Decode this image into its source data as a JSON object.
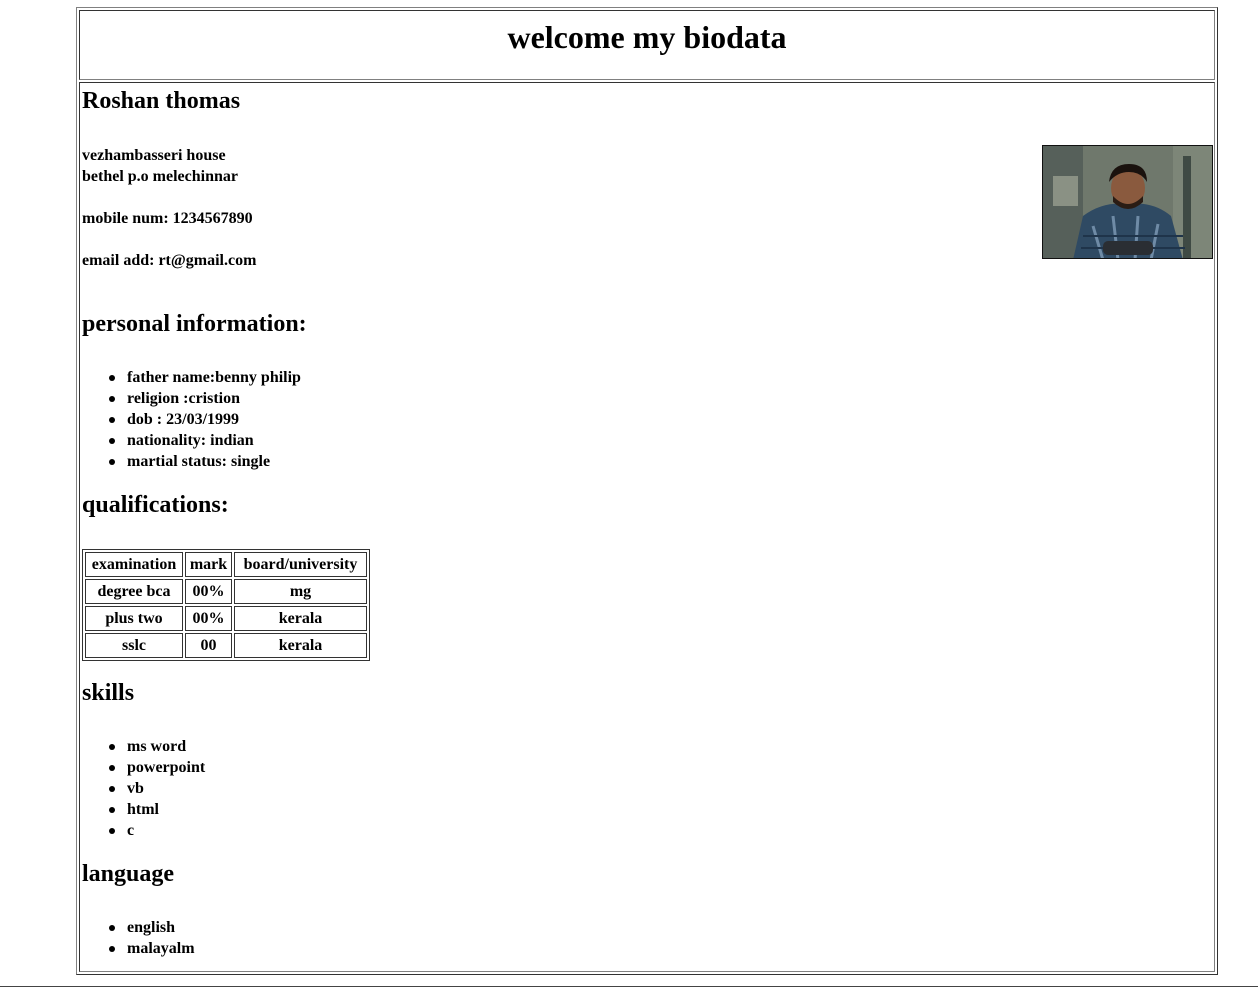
{
  "header": {
    "title": "welcome my biodata"
  },
  "profile": {
    "name": "Roshan thomas",
    "address_line1": "vezhambasseri house",
    "address_line2": "bethel p.o melechinnar",
    "mobile": "mobile num: 1234567890",
    "email": "email add: rt@gmail.com",
    "photo_alt": "profile-photo"
  },
  "personal": {
    "heading": "personal information:",
    "items": [
      "father name:benny philip",
      "religion :cristion",
      "dob : 23/03/1999",
      "nationality: indian",
      "martial status: single"
    ]
  },
  "qualifications": {
    "heading": "qualifications:",
    "columns": [
      "examination",
      "mark",
      "board/university"
    ],
    "rows": [
      [
        "degree bca",
        "00%",
        "mg"
      ],
      [
        "plus two",
        "00%",
        "kerala"
      ],
      [
        "sslc",
        "00",
        "kerala"
      ]
    ]
  },
  "skills": {
    "heading": "skills",
    "items": [
      "ms word",
      "powerpoint",
      "vb",
      "html",
      "c"
    ]
  },
  "language": {
    "heading": "language",
    "items": [
      "english",
      "malayalm"
    ]
  }
}
